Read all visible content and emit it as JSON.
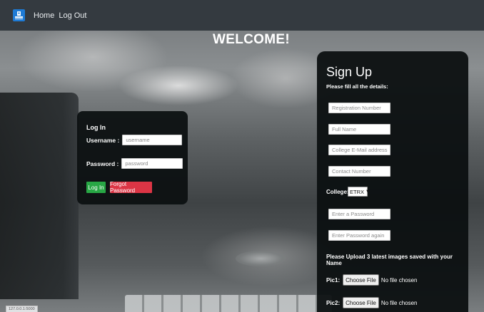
{
  "navbar": {
    "logo_icon": "graduation-logo-icon",
    "links": [
      "Home",
      "Log Out"
    ]
  },
  "heading": "WELCOME!",
  "login": {
    "title": "Log In",
    "username_label": "Username :",
    "username_placeholder": "username",
    "password_label": "Password :",
    "password_placeholder": "password",
    "login_button": "Log In",
    "forgot_button": "Forgot Password"
  },
  "signup": {
    "title": "Sign Up",
    "subtitle": "Please fill all the details:",
    "registration_placeholder": "Registration Number",
    "fullname_placeholder": "Full Name",
    "email_placeholder": "College E-Mail address",
    "contact_placeholder": "Contact Number",
    "college_label": "College:",
    "college_selected": "ETRX",
    "password_placeholder": "Enter a Password",
    "password_again_placeholder": "Enter Password again",
    "upload_label": "Please Upload 3 latest images saved with your Name",
    "pic1_label": "Pic1:",
    "pic2_label": "Pic2:",
    "choose_file": "Choose File",
    "no_file": "No file chosen"
  },
  "status_url": "127.0.0.1:5000",
  "colors": {
    "navbar": "#343a40",
    "card": "#0c1011",
    "login_green": "#28a745",
    "forgot_red": "#dc3545",
    "logo_blue": "#1e7bd6"
  }
}
